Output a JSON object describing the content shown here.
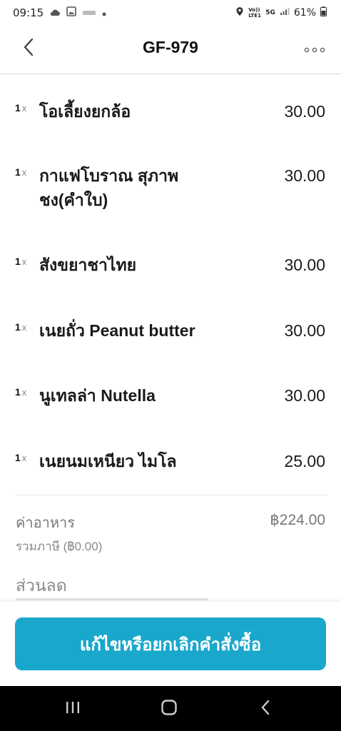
{
  "status_bar": {
    "time": "09:15",
    "battery": "61%",
    "icons": [
      "cloud-icon",
      "image-icon",
      "notification-icon",
      "dot-icon",
      "location-icon",
      "volte-icon",
      "5g-icon",
      "signal-icon",
      "battery-icon"
    ],
    "volte_text": "Vo)) LTE1",
    "network_text": "5G"
  },
  "header": {
    "title": "GF-979",
    "back_icon": "chevron-left-icon",
    "more_icon": "more-horizontal-icon"
  },
  "items": [
    {
      "qty": "1",
      "x": "x",
      "name": "โอเลี้ยงยกล้อ",
      "price": "30.00"
    },
    {
      "qty": "1",
      "x": "x",
      "name": "กาแฟโบราณ สุภาพชง(คำใบ)",
      "price": "30.00"
    },
    {
      "qty": "1",
      "x": "x",
      "name": "สังขยาชาไทย",
      "price": "30.00"
    },
    {
      "qty": "1",
      "x": "x",
      "name": "เนยถั่ว Peanut butter",
      "price": "30.00"
    },
    {
      "qty": "1",
      "x": "x",
      "name": "นูเทลล่า Nutella",
      "price": "30.00"
    },
    {
      "qty": "1",
      "x": "x",
      "name": "เนยนมเหนียว ไมโล",
      "price": "25.00"
    }
  ],
  "summary": {
    "food_label": "ค่าอาหาร",
    "tax_label": "รวมภาษี (฿0.00)",
    "food_amount": "฿224.00",
    "discount_label": "ส่วนลด"
  },
  "action": {
    "edit_cancel_label": "แก้ไขหรือยกเลิกคำสั่งซื้อ"
  },
  "nav": {
    "recent_icon": "recent-apps-icon",
    "home_icon": "home-icon",
    "back_icon": "back-icon"
  },
  "colors": {
    "accent": "#1aa7cc",
    "nav_bg": "#000000"
  }
}
